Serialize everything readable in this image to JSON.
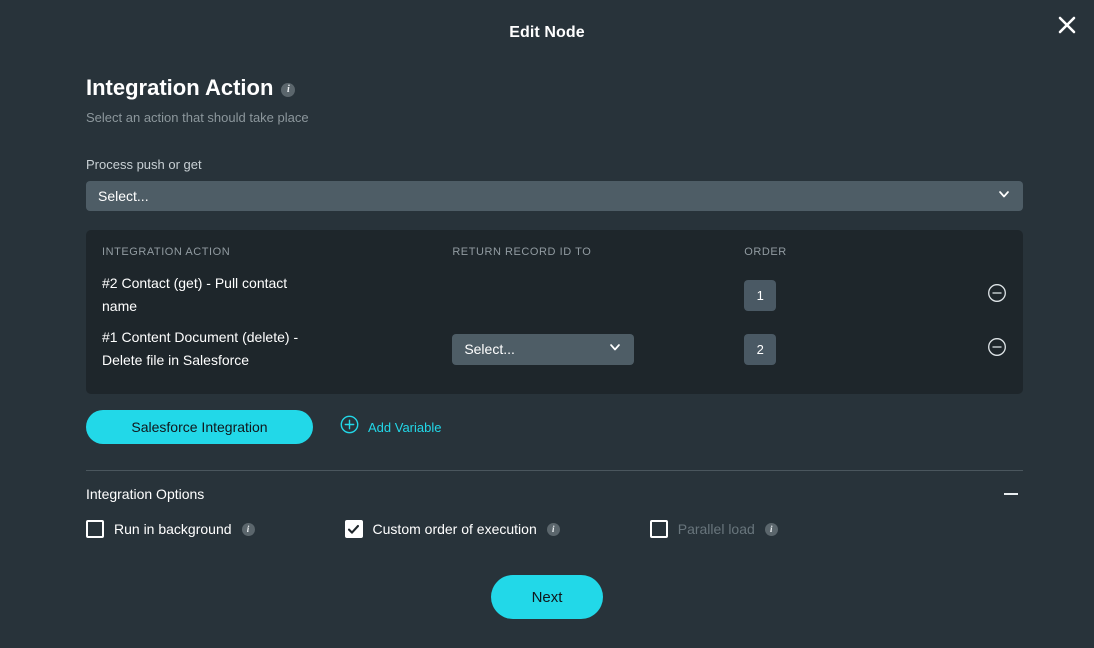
{
  "header": {
    "title": "Edit Node",
    "close_icon": "close-icon"
  },
  "section": {
    "title": "Integration Action",
    "subtitle": "Select an action that should take place",
    "info_icon": "info-icon",
    "info_char": "i"
  },
  "process_field": {
    "label": "Process push or get",
    "value": "Select...",
    "chevron_icon": "chevron-down-icon"
  },
  "table": {
    "columns": [
      "INTEGRATION ACTION",
      "RETURN RECORD ID TO",
      "ORDER"
    ],
    "rows": [
      {
        "action": "#2 Contact (get) - Pull contact name",
        "return_record_id_to": null,
        "order": "1",
        "remove_icon": "minus-circle-icon"
      },
      {
        "action": "#1 Content Document (delete) - Delete file in Salesforce",
        "return_record_id_to": "Select...",
        "order": "2",
        "remove_icon": "minus-circle-icon"
      }
    ]
  },
  "actions": {
    "integration_button": "Salesforce Integration",
    "add_variable_label": "Add Variable",
    "add_variable_icon": "plus-circle-icon"
  },
  "options": {
    "title": "Integration Options",
    "collapse_icon": "minus-icon",
    "items": [
      {
        "label": "Run in background",
        "checked": false,
        "disabled": false,
        "info_char": "i"
      },
      {
        "label": "Custom order of execution",
        "checked": true,
        "disabled": false,
        "info_char": "i"
      },
      {
        "label": "Parallel load",
        "checked": false,
        "disabled": true,
        "info_char": "i"
      }
    ]
  },
  "footer": {
    "next_label": "Next"
  },
  "colors": {
    "background": "#28333a",
    "panel": "#1e262b",
    "accent": "#22d8e8",
    "input": "#4e5d66",
    "order_box": "#4a5964",
    "muted_text": "#8c979c",
    "disabled_text": "#68757c"
  }
}
